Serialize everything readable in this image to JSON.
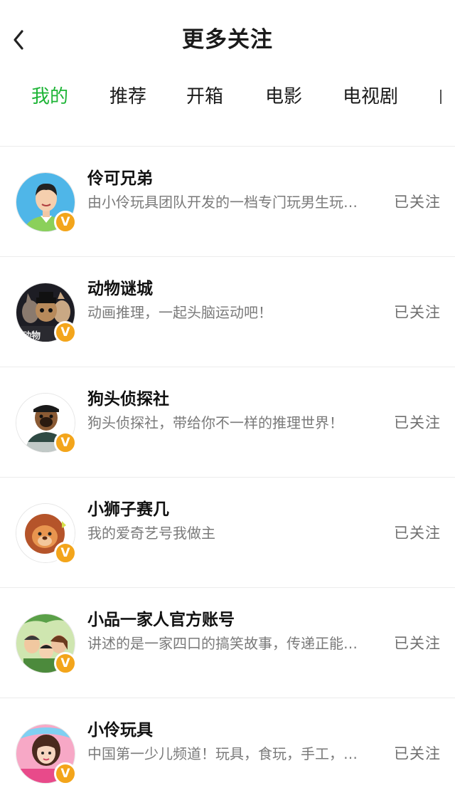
{
  "header": {
    "title": "更多关注"
  },
  "tabs": [
    {
      "label": "我的",
      "active": true
    },
    {
      "label": "推荐",
      "active": false
    },
    {
      "label": "开箱",
      "active": false
    },
    {
      "label": "电影",
      "active": false
    },
    {
      "label": "电视剧",
      "active": false
    }
  ],
  "colors": {
    "accent": "#1db436",
    "badge": "#f3a51b"
  },
  "list": [
    {
      "name": "伶可兄弟",
      "desc": "由小伶玩具团队开发的一档专门玩男生玩…",
      "follow": "已关注",
      "badge": "V",
      "avatar_icon": "boy-avatar-icon"
    },
    {
      "name": "动物谜城",
      "desc": "动画推理，一起头脑运动吧！",
      "follow": "已关注",
      "badge": "V",
      "avatar_icon": "animal-avatar-icon"
    },
    {
      "name": "狗头侦探社",
      "desc": "狗头侦探社，带给你不一样的推理世界！",
      "follow": "已关注",
      "badge": "V",
      "avatar_icon": "dog-avatar-icon"
    },
    {
      "name": "小狮子赛几",
      "desc": "我的爱奇艺号我做主",
      "follow": "已关注",
      "badge": "V",
      "avatar_icon": "lion-avatar-icon"
    },
    {
      "name": "小品一家人官方账号",
      "desc": "讲述的是一家四口的搞笑故事，传递正能…",
      "follow": "已关注",
      "badge": "V",
      "avatar_icon": "family-avatar-icon"
    },
    {
      "name": "小伶玩具",
      "desc": "中国第一少儿频道！玩具，食玩，手工，…",
      "follow": "已关注",
      "badge": "V",
      "avatar_icon": "girl-avatar-icon"
    }
  ]
}
